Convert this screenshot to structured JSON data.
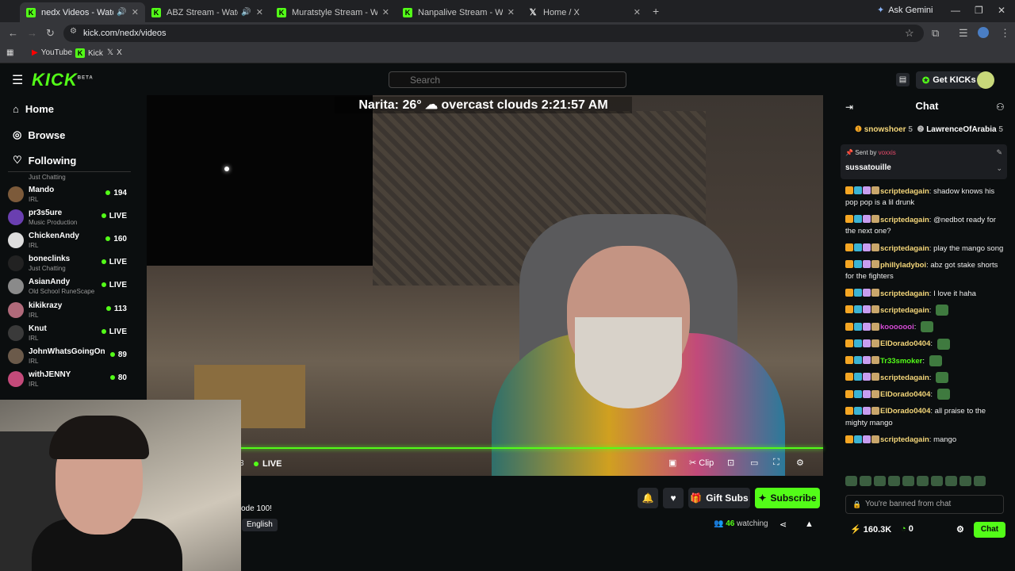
{
  "browser": {
    "tabs": [
      {
        "label": "nedx Videos - Watch On-D",
        "icon": "kick-icon",
        "active": true,
        "audio": true
      },
      {
        "label": "ABZ Stream - Watch Live o",
        "icon": "kick-icon",
        "audio": true
      },
      {
        "label": "Muratstyle Stream - Watch Live",
        "icon": "kick-icon"
      },
      {
        "label": "Nanpalive Stream - Watch Live",
        "icon": "kick-icon"
      },
      {
        "label": "Home / X",
        "icon": "x-icon"
      }
    ],
    "ask_gemini": "Ask Gemini",
    "url": "kick.com/nedx/videos",
    "bookmarks": [
      {
        "label": "YouTube",
        "icon": "youtube-icon"
      },
      {
        "label": "Kick",
        "icon": "kick-icon"
      },
      {
        "label": "X",
        "icon": "x-icon"
      }
    ]
  },
  "header": {
    "logo": "KICK",
    "logo_sup": "BETA",
    "search_placeholder": "Search",
    "get_kicks": "Get KICKs"
  },
  "sidebar": {
    "nav": [
      {
        "label": "Home",
        "icon": "home-icon"
      },
      {
        "label": "Browse",
        "icon": "compass-icon"
      },
      {
        "label": "Following",
        "icon": "heart-icon"
      }
    ],
    "top_category": "Just Chatting",
    "channels": [
      {
        "name": "Mando",
        "category": "IRL",
        "viewers": "194"
      },
      {
        "name": "pr3s5ure",
        "category": "Music Production",
        "viewers": "LIVE"
      },
      {
        "name": "ChickenAndy",
        "category": "IRL",
        "viewers": "160"
      },
      {
        "name": "boneclinks",
        "category": "Just Chatting",
        "viewers": "LIVE"
      },
      {
        "name": "AsianAndy",
        "category": "Old School RuneScape",
        "viewers": "LIVE"
      },
      {
        "name": "kikikrazy",
        "category": "IRL",
        "viewers": "113"
      },
      {
        "name": "Knut",
        "category": "IRL",
        "viewers": "LIVE"
      },
      {
        "name": "JohnWhatsGoingOn",
        "category": "IRL",
        "viewers": "89"
      },
      {
        "name": "withJENNY",
        "category": "IRL",
        "viewers": "80"
      }
    ]
  },
  "player": {
    "overlay": "Narita: 26° ☁ overcast clouds 2:21:57 AM",
    "time": "3",
    "live": "LIVE",
    "clip": "Clip"
  },
  "meta": {
    "title_fragment": "ode 100!",
    "language": "English",
    "gift_subs": "Gift Subs",
    "subscribe": "Subscribe",
    "watching_count": "46",
    "watching_label": "watching"
  },
  "chat": {
    "title": "Chat",
    "leaderboard": [
      {
        "name": "snowshoer",
        "count": "5"
      },
      {
        "name": "LawrenceOfArabia",
        "count": "5"
      }
    ],
    "pinned": {
      "sent_by": "Sent by",
      "sender": "voxxis",
      "user": "sussatouille"
    },
    "messages": [
      {
        "user": "scriptedagain",
        "color": "#f5d77a",
        "text": "shadow knows his pop pop is a lil drunk"
      },
      {
        "user": "scriptedagain",
        "color": "#f5d77a",
        "text": "@nedbot ready for the next one?"
      },
      {
        "user": "scriptedagain",
        "color": "#f5d77a",
        "text": "play the mango song"
      },
      {
        "user": "phillyladyboi",
        "color": "#f5d77a",
        "text": "abz got stake shorts for the fighters"
      },
      {
        "user": "scriptedagain",
        "color": "#f5d77a",
        "text": "I love it haha"
      },
      {
        "user": "scriptedagain",
        "color": "#f5d77a",
        "text": ""
      },
      {
        "user": "kooooooi",
        "color": "#d64bd6",
        "text": ""
      },
      {
        "user": "ElDorado0404",
        "color": "#f5d77a",
        "text": ""
      },
      {
        "user": "Tr33smoker",
        "color": "#53fc18",
        "text": ""
      },
      {
        "user": "scriptedagain",
        "color": "#f5d77a",
        "text": ""
      },
      {
        "user": "ElDorado0404",
        "color": "#f5d77a",
        "text": ""
      },
      {
        "user": "ElDorado0404",
        "color": "#f5d77a",
        "text": "all praise to the mighty mango"
      },
      {
        "user": "scriptedagain",
        "color": "#f5d77a",
        "text": "mango"
      }
    ],
    "banned": "You're banned from chat",
    "kicks": "160.3K",
    "points": "0",
    "chat_button": "Chat"
  },
  "colors": {
    "accent": "#53fc18",
    "bg": "#0b0e0f"
  }
}
